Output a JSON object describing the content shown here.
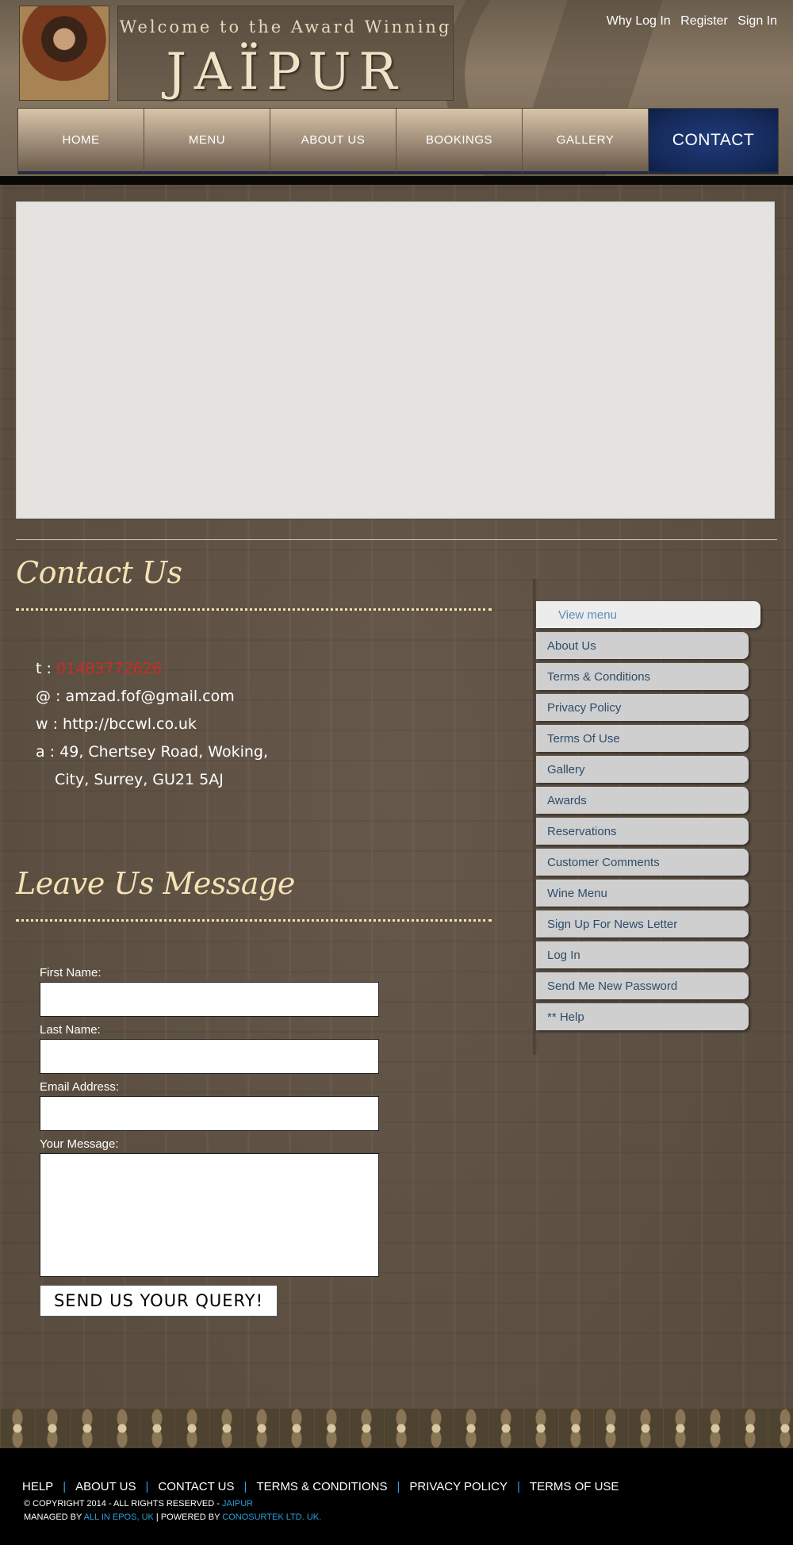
{
  "header": {
    "banner_tagline": "Welcome to the Award Winning",
    "banner_name": "JAÏPUR",
    "top_links": [
      "Why Log In",
      "Register",
      "Sign In"
    ]
  },
  "nav": {
    "items": [
      "HOME",
      "MENU",
      "ABOUT US",
      "BOOKINGS",
      "GALLERY",
      "CONTACT"
    ],
    "active": "CONTACT",
    "active_color": "#1f3a78"
  },
  "contact": {
    "title": "Contact Us",
    "phone_prefix": "t :",
    "phone": "01483772626",
    "email_prefix": "@ :",
    "email": "amzad.fof@gmail.com",
    "web_prefix": "w :",
    "web": "http://bccwl.co.uk",
    "address_prefix": "a :",
    "address_line1": "49, Chertsey Road, Woking,",
    "address_line2": "City, Surrey, GU21 5AJ",
    "phone_color": "#d02a24"
  },
  "message": {
    "title": "Leave Us Message",
    "first_name_label": "First Name:",
    "last_name_label": "Last Name:",
    "email_label": "Email Address:",
    "message_label": "Your Message:",
    "first_name_value": "",
    "last_name_value": "",
    "email_value": "",
    "message_value": "",
    "submit_label": "SEND US YOUR QUERY!"
  },
  "sidebar": {
    "head": "View menu",
    "items": [
      "About Us",
      "Terms & Conditions",
      "Privacy Policy",
      "Terms Of Use",
      "Gallery",
      "Awards",
      "Reservations",
      "Customer Comments",
      "Wine Menu",
      "Sign Up For News Letter",
      "Log In",
      "Send Me New Password",
      "** Help"
    ]
  },
  "footer": {
    "links": [
      "HELP",
      "ABOUT US",
      "CONTACT US",
      "TERMS & CONDITIONS",
      "PRIVACY POLICY",
      "TERMS OF USE"
    ],
    "separator": "|",
    "copyright_text": "© COPYRIGHT 2014 - ALL RIGHTS RESERVED -",
    "copyright_brand": "JAIPUR",
    "managed_prefix": "MANAGED BY",
    "managed_by": "ALL IN EPOS, UK",
    "powered_prefix": "| POWERED BY",
    "powered_by": "CONOSURTEK LTD. UK.",
    "link_color": "#2a9fd6"
  }
}
